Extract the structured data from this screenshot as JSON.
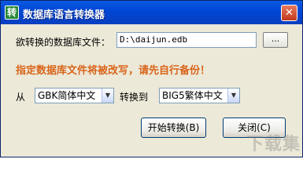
{
  "window": {
    "title": "数据库语言转换器",
    "app_icon": "转"
  },
  "file_row": {
    "label": "欲转换的数据库文件：",
    "path_value": "D:\\daijun.edb",
    "browse_label": "..."
  },
  "warning": "指定数据库文件将被改写，请先自行备份！",
  "conversion": {
    "from_label": "从",
    "from_value": "GBK简体中文",
    "to_label": "转换到",
    "to_value": "BIG5繁体中文"
  },
  "buttons": {
    "start_label": "开始转换(B)",
    "close_label": "关闭(C)"
  },
  "watermark": "下载集",
  "colors": {
    "titlebar": "#0046D5",
    "warning_text": "#D9641A",
    "window_bg": "#ECE9D8"
  }
}
